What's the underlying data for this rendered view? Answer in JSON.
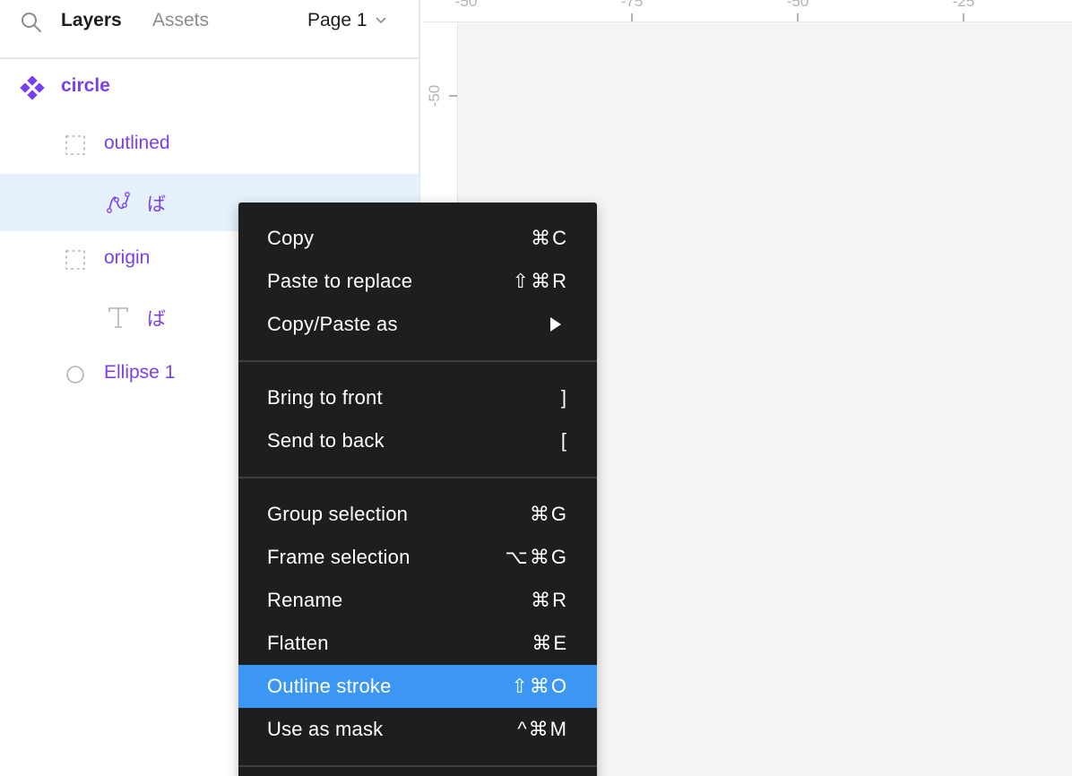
{
  "panel": {
    "tabs": {
      "layers": "Layers",
      "assets": "Assets"
    },
    "page_selector": "Page 1",
    "layers": [
      {
        "name": "circle",
        "icon": "component-icon"
      },
      {
        "name": "outlined",
        "icon": "frame-dashed-icon"
      },
      {
        "name": "ば",
        "icon": "vector-pen-icon",
        "selected": true
      },
      {
        "name": "origin",
        "icon": "frame-dashed-icon"
      },
      {
        "name": "ば",
        "icon": "text-icon"
      },
      {
        "name": "Ellipse 1",
        "icon": "ellipse-icon"
      }
    ]
  },
  "ruler": {
    "top_labels": [
      "-50",
      "-75",
      "-50",
      "-25"
    ],
    "left_labels": [
      "-50"
    ]
  },
  "context_menu": {
    "items": [
      {
        "label": "Copy",
        "shortcut": "⌘C"
      },
      {
        "label": "Paste to replace",
        "shortcut": "⇧⌘R"
      },
      {
        "label": "Copy/Paste as",
        "submenu": true
      },
      {
        "label": "Bring to front",
        "shortcut": "]"
      },
      {
        "label": "Send to back",
        "shortcut": "["
      },
      {
        "label": "Group selection",
        "shortcut": "⌘G"
      },
      {
        "label": "Frame selection",
        "shortcut": "⌥⌘G"
      },
      {
        "label": "Rename",
        "shortcut": "⌘R"
      },
      {
        "label": "Flatten",
        "shortcut": "⌘E"
      },
      {
        "label": "Outline stroke",
        "shortcut": "⇧⌘O",
        "highlighted": true
      },
      {
        "label": "Use as mask",
        "shortcut": "^⌘M"
      }
    ]
  },
  "colors": {
    "accent_purple": "#7b3ff2",
    "selection_blue": "#3b97f3",
    "row_selected_bg": "#e5f1fc",
    "menu_bg": "#1e1e1e"
  }
}
